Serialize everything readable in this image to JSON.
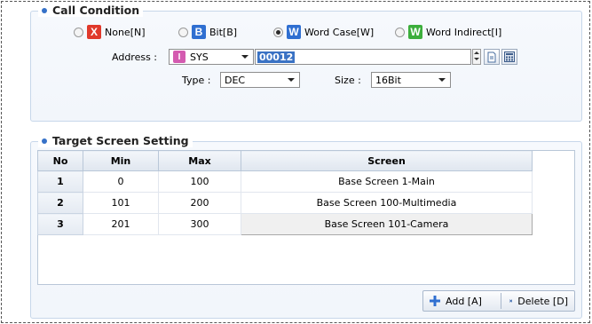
{
  "call_condition": {
    "title": "Call Condition",
    "options": [
      {
        "badge": "X",
        "label": "None[N]",
        "color": "#e0392b",
        "selected": false
      },
      {
        "badge": "B",
        "label": "Bit[B]",
        "color": "#2f6fd1",
        "selected": false
      },
      {
        "badge": "W",
        "label": "Word Case[W]",
        "color": "#2f6fd1",
        "selected": true
      },
      {
        "badge": "W",
        "label": "Word Indirect[I]",
        "color": "#3cae3c",
        "selected": false
      }
    ],
    "address_label": "Address :",
    "address_device_badge": "I",
    "address_device": "SYS",
    "address_value": "00012",
    "type_label": "Type :",
    "type_value": "DEC",
    "size_label": "Size :",
    "size_value": "16Bit"
  },
  "target_screen": {
    "title": "Target Screen Setting",
    "columns": [
      "No",
      "Min",
      "Max",
      "Screen"
    ],
    "rows": [
      {
        "no": "1",
        "min": "0",
        "max": "100",
        "screen": "Base Screen 1-Main"
      },
      {
        "no": "2",
        "min": "101",
        "max": "200",
        "screen": "Base Screen 100-Multimedia"
      },
      {
        "no": "3",
        "min": "201",
        "max": "300",
        "screen": "Base Screen 101-Camera"
      }
    ],
    "add_label": "Add [A]",
    "delete_label": "Delete [D]"
  },
  "colors": {
    "accent_blue": "#2f6fd1",
    "bullet": "#3571c8",
    "panel_border": "#c7d7ea",
    "selection": "#3a72c4"
  }
}
